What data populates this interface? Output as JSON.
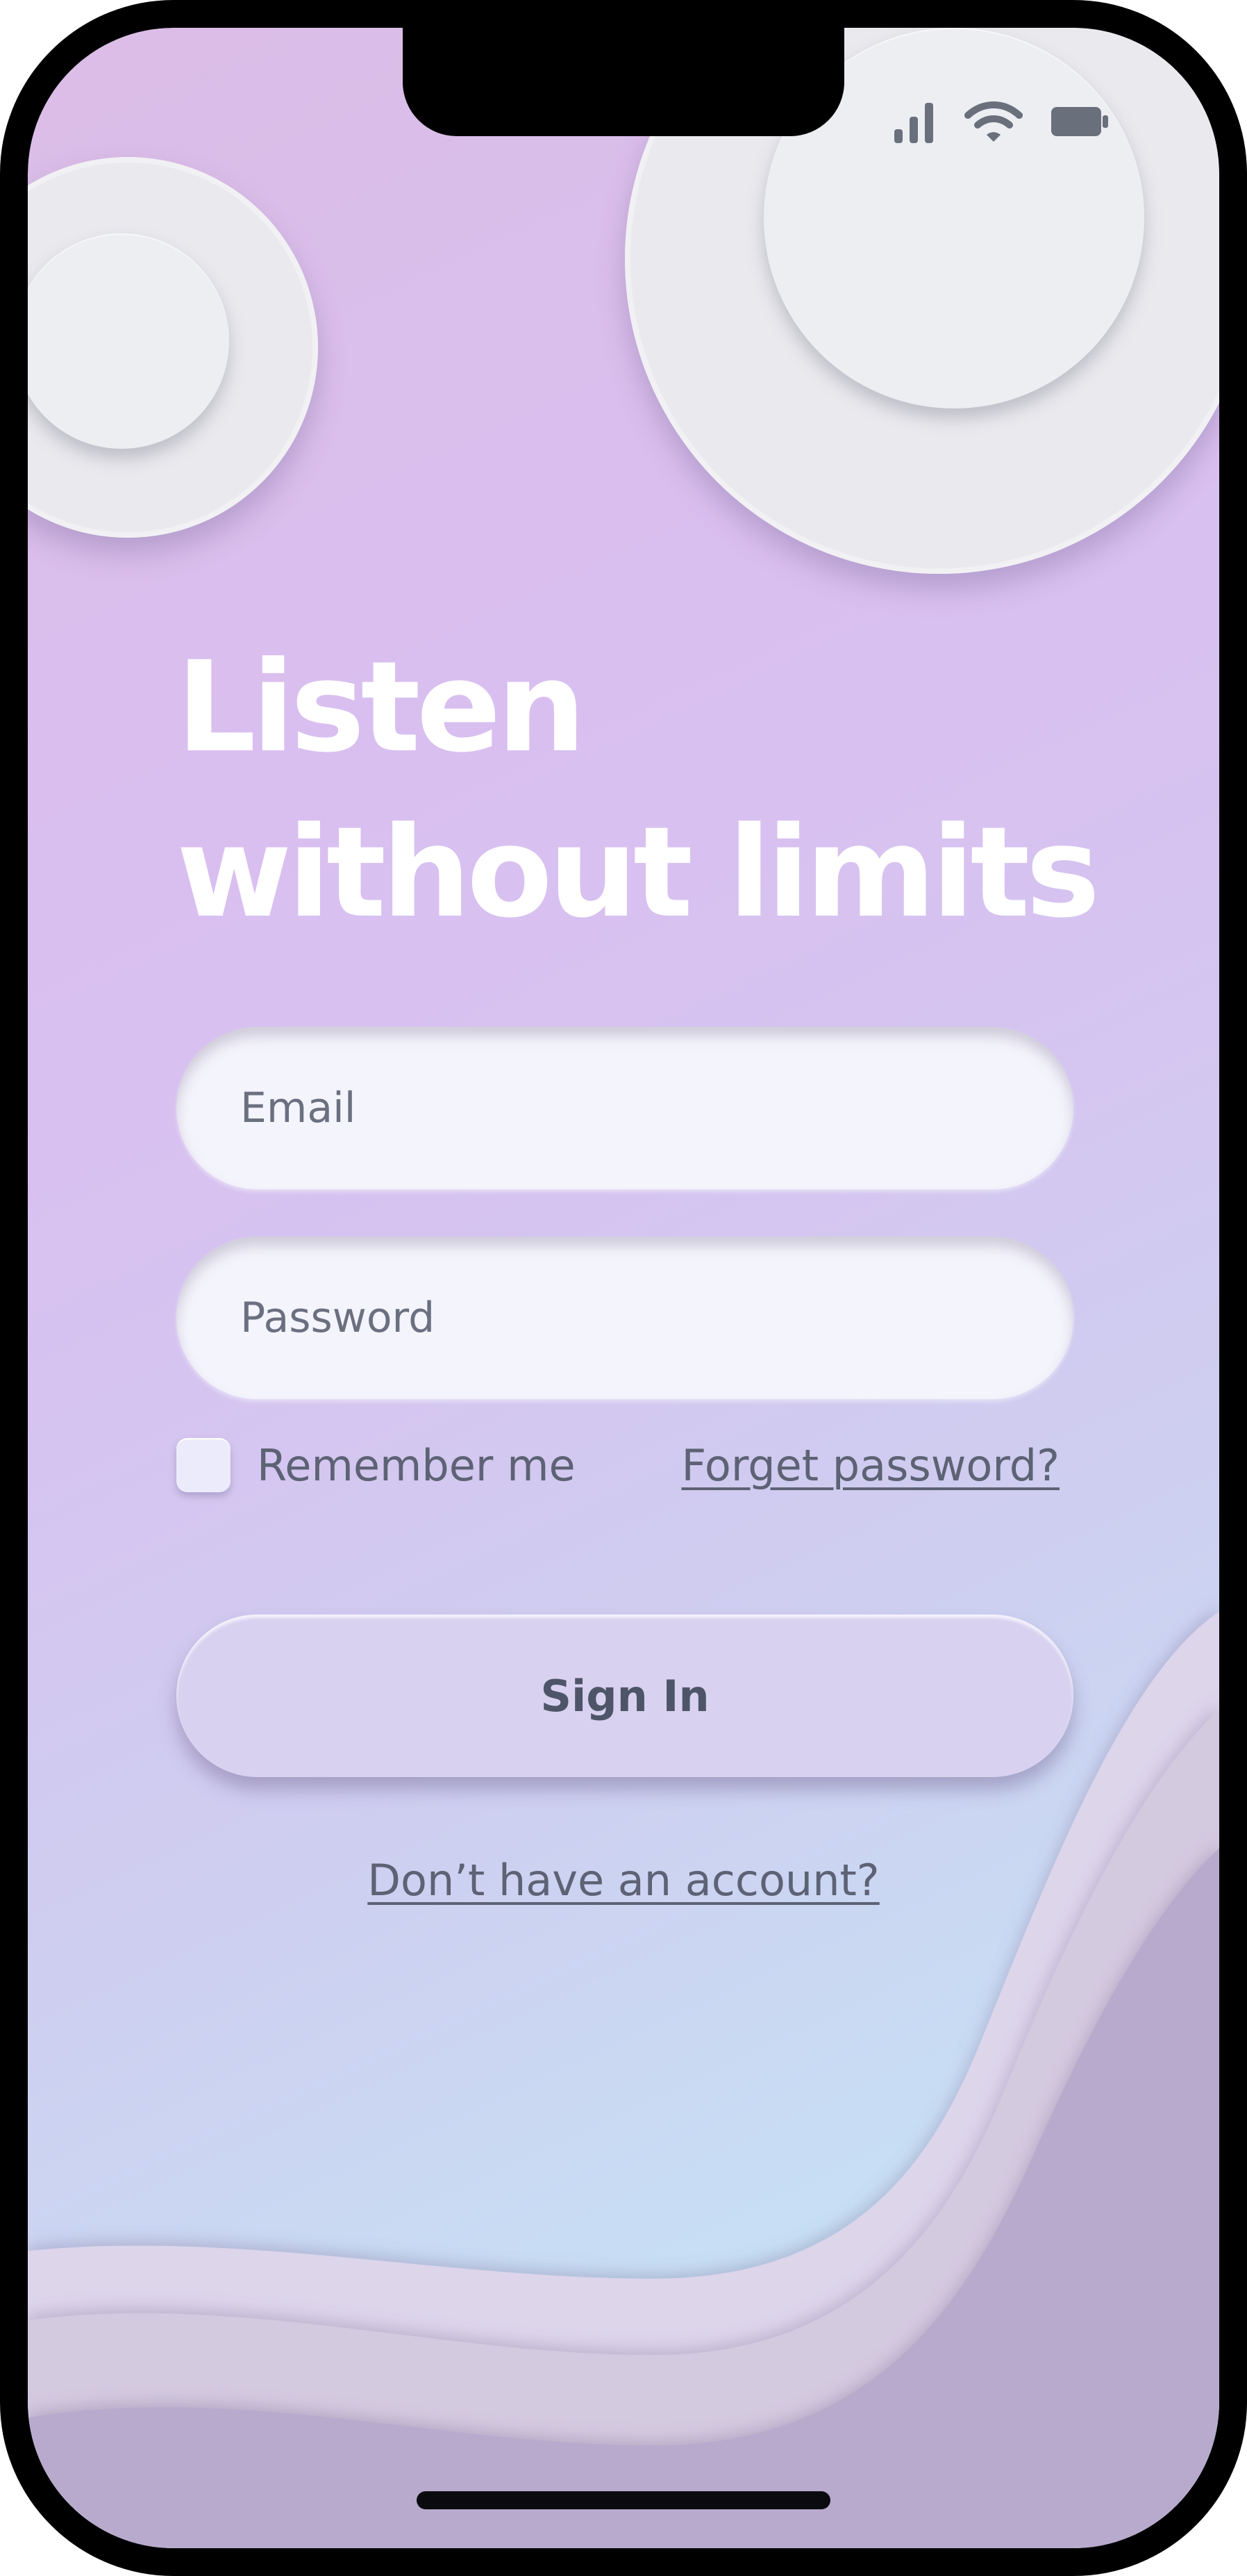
{
  "headline": {
    "line1": "Listen",
    "line2": "without limits"
  },
  "form": {
    "email_placeholder": "Email",
    "password_placeholder": "Password",
    "remember_label": "Remember me",
    "forgot_label": "Forget password?",
    "signin_label": "Sign In",
    "signup_label": "Don’t have an account?"
  },
  "status_bar": {
    "icons": [
      "signal-icon",
      "wifi-icon",
      "battery-icon"
    ]
  },
  "colors": {
    "headline": "#ffffff",
    "text": "#5d6274",
    "button": "#d8d2f0",
    "field": "#f4f4fc"
  }
}
